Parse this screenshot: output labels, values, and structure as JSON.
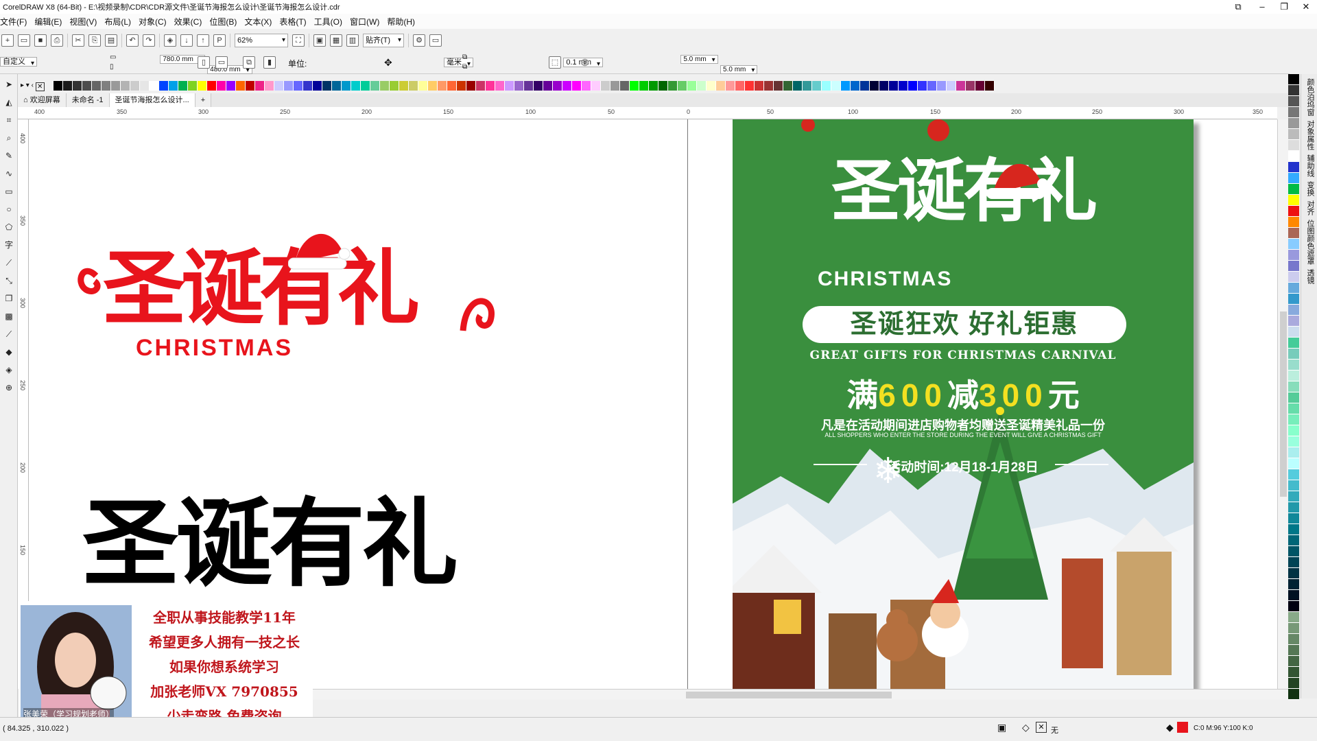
{
  "window": {
    "title": "CorelDRAW X8 (64-Bit) - E:\\视频录制\\CDR\\CDR源文件\\圣诞节海报怎么设计\\圣诞节海报怎么设计.cdr"
  },
  "menu": [
    "文件(F)",
    "编辑(E)",
    "视图(V)",
    "布局(L)",
    "对象(C)",
    "效果(C)",
    "位图(B)",
    "文本(X)",
    "表格(T)",
    "工具(O)",
    "窗口(W)",
    "帮助(H)"
  ],
  "toolbar": {
    "zoom": "62%",
    "snap_label": "贴齐(T)"
  },
  "propertybar": {
    "preset": "自定义",
    "width": "780.0 mm",
    "height": "480.0 mm",
    "unit_label": "单位:",
    "unit": "毫米",
    "nudge": "0.1 mm",
    "dup_x": "5.0 mm",
    "dup_y": "5.0 mm"
  },
  "doc_tabs": [
    "欢迎屏幕",
    "未命名 -1",
    "圣诞节海报怎么设计..."
  ],
  "ruler_top": [
    "400",
    "350",
    "300",
    "250",
    "200",
    "150",
    "100",
    "50",
    "0",
    "50",
    "100",
    "150",
    "200",
    "250",
    "300",
    "350"
  ],
  "ruler_side": [
    "400",
    "350",
    "300",
    "250",
    "200",
    "150"
  ],
  "artwork": {
    "red_title": "圣诞有礼",
    "red_sub": "CHRISTMAS",
    "black_title": "圣诞有礼"
  },
  "poster": {
    "title": "圣诞有礼",
    "christmas": "CHRISTMAS",
    "banner": "圣诞狂欢  好礼钜惠",
    "gifts": "GREAT GIFTS FOR CHRISTMAS CARNIVAL",
    "offer_a": "满",
    "offer_b": "600",
    "offer_c": "减",
    "offer_d": "300",
    "offer_e": "元",
    "desc_cn": "凡是在活动期间进店购物者均赠送圣诞精美礼品一份",
    "desc_en": "ALL SHOPPERS WHO ENTER THE STORE DURING THE EVENT WILL GIVE A CHRISTMAS GIFT",
    "time": "活动时间:12月18-1月28日"
  },
  "promo": {
    "lines": [
      "全职从事技能教学11年",
      "希望更多人拥有一技之长",
      "如果你想系统学习",
      "加张老师VX 7970855",
      "少走弯路 免费咨询"
    ],
    "name": "张美荣（学习规划老师）"
  },
  "dockers": [
    "颜色泊坞窗",
    "对象属性",
    "辅助线",
    "变换",
    "对齐",
    "位图颜色遮罩",
    "透镜"
  ],
  "status": {
    "coords": "( 84.325 , 310.022 )",
    "fill_none": "无",
    "fill_info": "C:0 M:96 Y:100 K:0"
  },
  "colors": {
    "accent_red": "#e8141c",
    "poster_green": "#3a8f3e",
    "yellow": "#f3e021"
  }
}
